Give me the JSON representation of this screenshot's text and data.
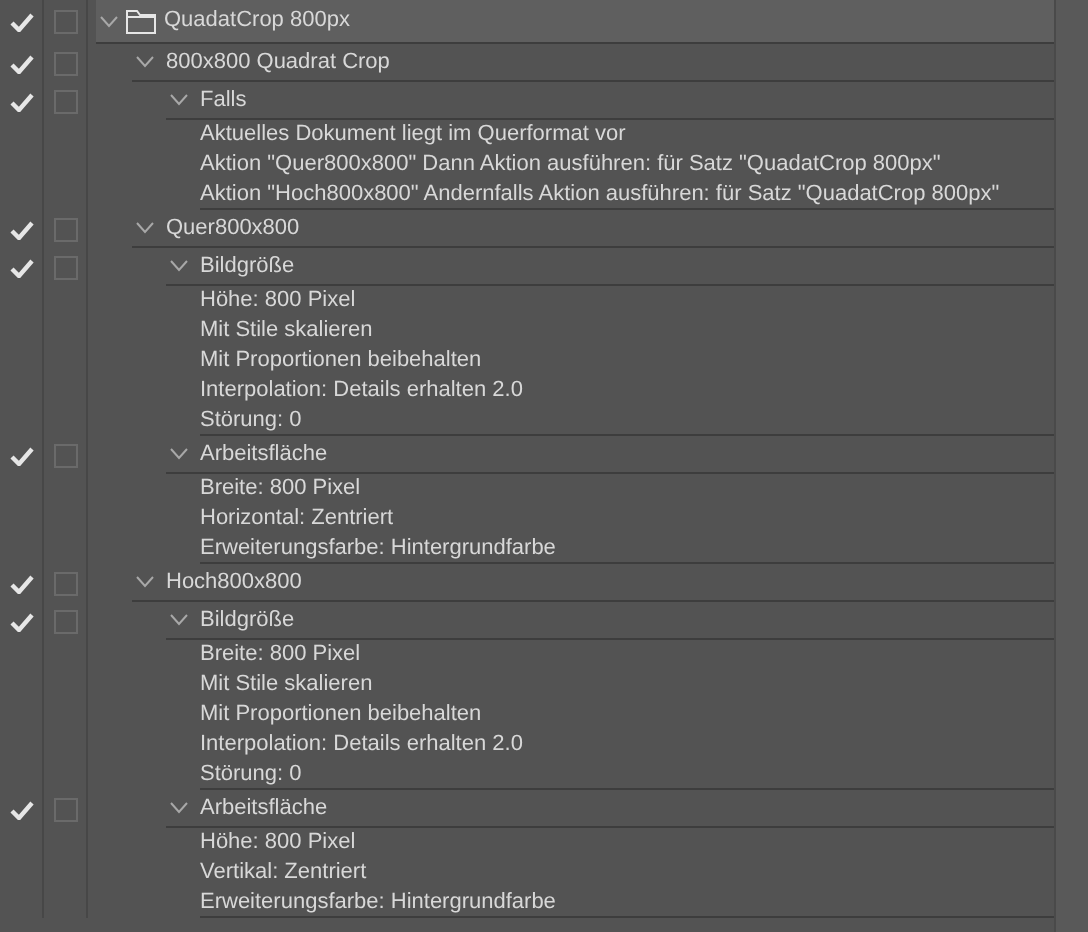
{
  "action_set": {
    "name": "QuadatCrop 800px",
    "checked": true,
    "dialog": false,
    "expanded": true,
    "selected": true,
    "actions": [
      {
        "name": "800x800 Quadrat Crop",
        "checked": true,
        "dialog": false,
        "expanded": true,
        "commands": [
          {
            "name": "Falls",
            "checked": true,
            "dialog": false,
            "expanded": true,
            "details": [
              "Aktuelles Dokument liegt im Querformat vor",
              "Aktion \"Quer800x800\" Dann Aktion ausführen:  für Satz \"QuadatCrop 800px\"",
              "Aktion \"Hoch800x800\" Andernfalls Aktion ausführen:  für Satz \"QuadatCrop 800px\""
            ]
          }
        ]
      },
      {
        "name": "Quer800x800",
        "checked": true,
        "dialog": false,
        "expanded": true,
        "commands": [
          {
            "name": "Bildgröße",
            "checked": true,
            "dialog": false,
            "expanded": true,
            "details": [
              "Höhe: 800 Pixel",
              "Mit Stile skalieren",
              "Mit Proportionen beibehalten",
              "Interpolation: Details erhalten 2.0",
              "Störung: 0"
            ]
          },
          {
            "name": "Arbeitsfläche",
            "checked": true,
            "dialog": false,
            "expanded": true,
            "details": [
              "Breite: 800 Pixel",
              "Horizontal: Zentriert",
              "Erweiterungsfarbe: Hintergrundfarbe"
            ]
          }
        ]
      },
      {
        "name": "Hoch800x800",
        "checked": true,
        "dialog": false,
        "expanded": true,
        "commands": [
          {
            "name": "Bildgröße",
            "checked": true,
            "dialog": false,
            "expanded": true,
            "details": [
              "Breite: 800 Pixel",
              "Mit Stile skalieren",
              "Mit Proportionen beibehalten",
              "Interpolation: Details erhalten 2.0",
              "Störung: 0"
            ]
          },
          {
            "name": "Arbeitsfläche",
            "checked": true,
            "dialog": false,
            "expanded": true,
            "details": [
              "Höhe: 800 Pixel",
              "Vertikal: Zentriert",
              "Erweiterungsfarbe: Hintergrundfarbe"
            ]
          }
        ]
      }
    ]
  }
}
